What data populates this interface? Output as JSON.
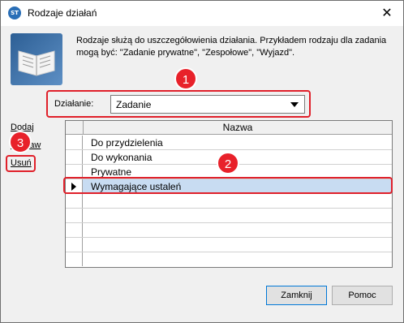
{
  "window": {
    "title": "Rodzaje działań",
    "app_icon_text": "ST",
    "close_glyph": "✕"
  },
  "header": {
    "icon": "book-icon",
    "description": "Rodzaje służą do uszczegółowienia działania. Przykładem rodzaju dla zadania mogą być: \"Zadanie prywatne\", \"Zespołowe\", \"Wyjazd\"."
  },
  "filter": {
    "label": "Działanie:",
    "selected": "Zadanie"
  },
  "side_actions": {
    "add": "Dodaj",
    "edit": "Popraw",
    "delete": "Usuń"
  },
  "grid": {
    "column": "Nazwa",
    "rows": [
      "Do przydzielenia",
      "Do wykonania",
      "Prywatne",
      "Wymagające ustaleń"
    ],
    "selected_row": "Wymagające ustaleń"
  },
  "callouts": {
    "one": "1",
    "two": "2",
    "three": "3",
    "color": "#e0202a"
  },
  "buttons": {
    "close": "Zamknij",
    "help": "Pomoc"
  }
}
